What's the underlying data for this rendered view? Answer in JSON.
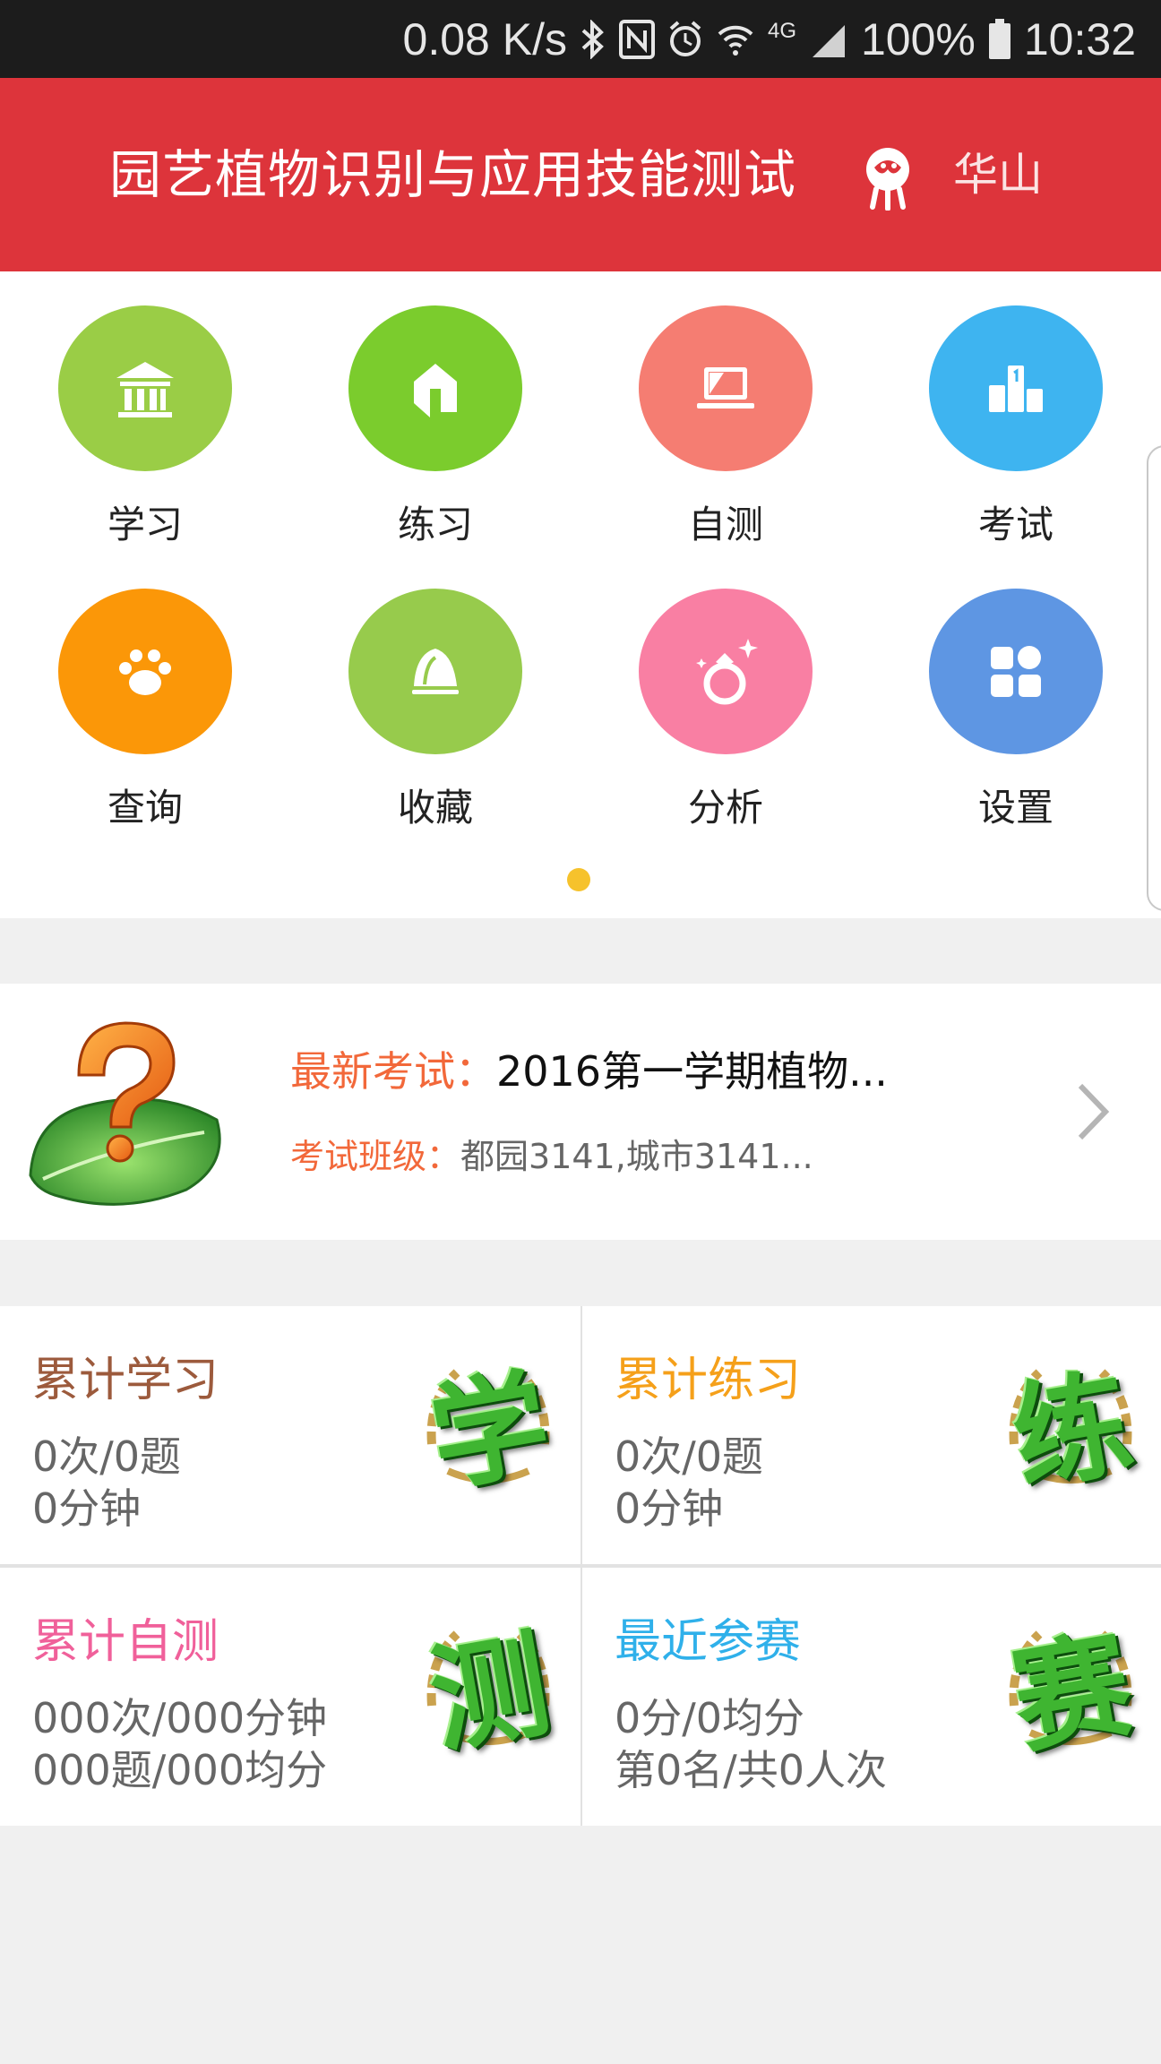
{
  "status_bar": {
    "net_speed": "0.08 K/s",
    "network_type": "4G",
    "battery": "100%",
    "time": "10:32",
    "icons": [
      "bluetooth-icon",
      "nfc-icon",
      "alarm-icon",
      "wifi-icon",
      "signal-icon",
      "battery-icon"
    ]
  },
  "header": {
    "title": "园艺植物识别与应用技能测试",
    "user": "华山",
    "background_color": "#dd343b"
  },
  "menu": {
    "items": [
      {
        "label": "学习",
        "icon": "museum-icon",
        "color": "#9acd46"
      },
      {
        "label": "练习",
        "icon": "home-icon",
        "color": "#7bcc2d"
      },
      {
        "label": "自测",
        "icon": "laptop-icon",
        "color": "#f57d72"
      },
      {
        "label": "考试",
        "icon": "podium-icon",
        "color": "#3eb4f0"
      },
      {
        "label": "查询",
        "icon": "paw-icon",
        "color": "#fb9708"
      },
      {
        "label": "收藏",
        "icon": "bell-icon",
        "color": "#97cb4c"
      },
      {
        "label": "分析",
        "icon": "ring-icon",
        "color": "#f97fa3"
      },
      {
        "label": "设置",
        "icon": "grid-icon",
        "color": "#5e96e3"
      }
    ],
    "page_indicator_color": "#f6c22c"
  },
  "exam": {
    "latest_label": "最新考试：",
    "latest_value": "2016第一学期植物...",
    "class_label": "考试班级：",
    "class_value": "都园3141,城市3141..."
  },
  "stats": [
    {
      "title": "累计学习",
      "color": "#9c5a3c",
      "line1": "0次/0题",
      "line2": "0分钟",
      "glyph": "学"
    },
    {
      "title": "累计练习",
      "color": "#f5a01a",
      "line1": "0次/0题",
      "line2": "0分钟",
      "glyph": "练"
    },
    {
      "title": "累计自测",
      "color": "#f0609a",
      "line1": "000次/000分钟",
      "line2": "000题/000均分",
      "glyph": "测"
    },
    {
      "title": "最近参赛",
      "color": "#2fb0ea",
      "line1": "0分/0均分",
      "line2": "第0名/共0人次",
      "glyph": "赛"
    }
  ]
}
